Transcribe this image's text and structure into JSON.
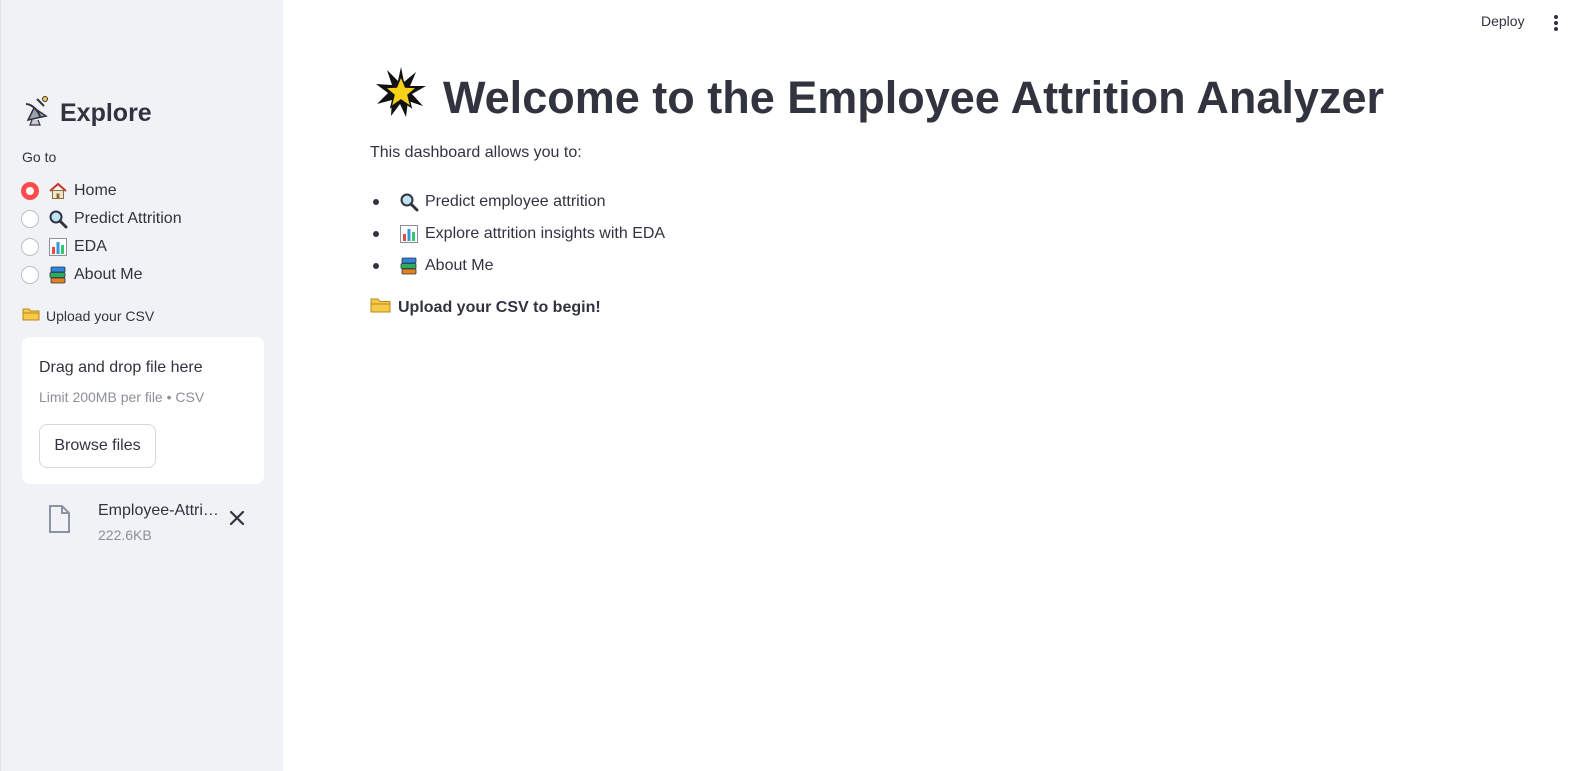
{
  "sidebar": {
    "title": "Explore",
    "title_icon": "satellite-antenna-icon",
    "goto_label": "Go to",
    "nav": [
      {
        "label": "Home",
        "icon": "house-icon",
        "selected": true
      },
      {
        "label": "Predict Attrition",
        "icon": "magnifier-icon",
        "selected": false
      },
      {
        "label": "EDA",
        "icon": "bar-chart-icon",
        "selected": false
      },
      {
        "label": "About Me",
        "icon": "books-icon",
        "selected": false
      }
    ],
    "upload": {
      "label": "Upload your CSV",
      "icon": "folder-icon",
      "drop_title": "Drag and drop file here",
      "limit_text": "Limit 200MB per file • CSV",
      "browse_label": "Browse files",
      "file": {
        "name": "Employee-Attrition.csv",
        "size": "222.6KB"
      }
    }
  },
  "topbar": {
    "deploy_label": "Deploy",
    "menu_icon": "vertical-dots-icon"
  },
  "main": {
    "title": "Welcome to the Employee Attrition Analyzer",
    "title_icon": "glowing-star-icon",
    "intro": "This dashboard allows you to:",
    "bullets": [
      {
        "icon": "magnifier-icon",
        "text": "Predict employee attrition"
      },
      {
        "icon": "bar-chart-icon",
        "text": "Explore attrition insights with EDA"
      },
      {
        "icon": "books-icon",
        "text": "About Me"
      }
    ],
    "cta": "Upload your CSV to begin!"
  },
  "colors": {
    "accent": "#ff4b4b",
    "sidebar_bg": "#f0f2f6",
    "text": "#31333f",
    "muted": "#8c8f97"
  }
}
